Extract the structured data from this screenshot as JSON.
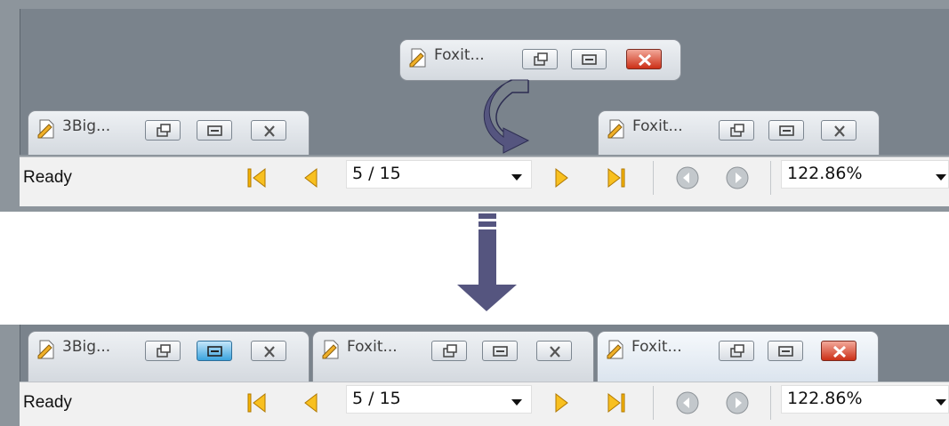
{
  "colors": {
    "accent_arrow": "#55557f",
    "title_close": "#d13a1f",
    "active_button": "#3aa3de",
    "nav_arrow": "#f6b400"
  },
  "icons": {
    "document": "foxit-document-icon",
    "restore": "restore-icon",
    "maximize": "maximize-icon",
    "close": "close-icon",
    "first": "first-page-icon",
    "prev": "previous-page-icon",
    "next": "next-page-icon",
    "last": "last-page-icon",
    "back": "go-back-icon",
    "forward": "go-forward-icon"
  },
  "top": {
    "floating_window": {
      "title": "Foxit..."
    },
    "tabs": [
      {
        "title": "3Big..."
      },
      {
        "title": "Foxit..."
      }
    ],
    "statusbar": {
      "status": "Ready",
      "page": "5 / 15",
      "zoom": "122.86%"
    }
  },
  "bottom": {
    "tabs": [
      {
        "title": "3Big..."
      },
      {
        "title": "Foxit..."
      },
      {
        "title": "Foxit..."
      }
    ],
    "statusbar": {
      "status": "Ready",
      "page": "5 / 15",
      "zoom": "122.86%"
    }
  }
}
